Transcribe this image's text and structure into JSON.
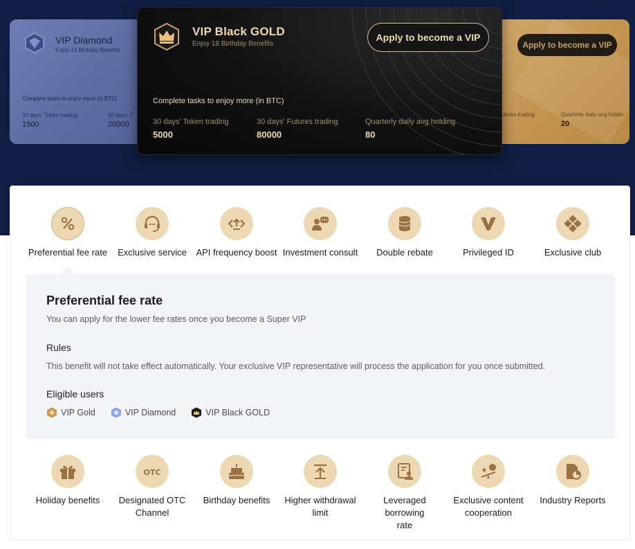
{
  "cards": {
    "diamond": {
      "title": "VIP Diamond",
      "subtitle": "Enjoy 13 Birthday Benefits",
      "tasks": "Complete tasks to enjoy more (in BTC)",
      "stats": [
        {
          "label": "30 days' Token trading",
          "value": "1500"
        },
        {
          "label": "30 days' F",
          "value": "20000"
        }
      ]
    },
    "black": {
      "title": "VIP Black GOLD",
      "subtitle": "Enjoy 18 Birthday Benefits",
      "apply_label": "Apply to become a VIP",
      "tasks": "Complete tasks to enjoy more (in BTC)",
      "stats": [
        {
          "label": "30 days' Token trading",
          "value": "5000"
        },
        {
          "label": "30 days' Futures trading",
          "value": "80000"
        },
        {
          "label": "Quarterly daily avg holding",
          "value": "80"
        }
      ]
    },
    "gold": {
      "apply_label": "Apply to become a VIP",
      "stats": [
        {
          "label": "utures trading",
          "value": ""
        },
        {
          "label": "Quarterly daily avg holdin",
          "value": "20"
        }
      ]
    }
  },
  "benefits_top": [
    {
      "label": "Preferential fee rate",
      "icon": "percent-icon"
    },
    {
      "label": "Exclusive service",
      "icon": "headset-icon"
    },
    {
      "label": "API frequency boost",
      "icon": "api-icon"
    },
    {
      "label": "Investment consult",
      "icon": "consult-icon"
    },
    {
      "label": "Double rebate",
      "icon": "coins-icon"
    },
    {
      "label": "Privileged ID",
      "icon": "v-icon"
    },
    {
      "label": "Exclusive club",
      "icon": "club-icon"
    }
  ],
  "detail": {
    "title": "Preferential fee rate",
    "description": "You can apply for the lower fee rates once you become a Super VIP",
    "rules_heading": "Rules",
    "rules_text": "This benefit will not take effect automatically. Your exclusive VIP representative will process the application for you once submitted.",
    "eligible_heading": "Eligible users",
    "eligible_users": [
      "VIP Gold",
      "VIP Diamond",
      "VIP Black GOLD"
    ]
  },
  "benefits_bottom": [
    {
      "line1": "Holiday benefits",
      "line2": "",
      "icon": "gift-icon"
    },
    {
      "line1": "Designated OTC",
      "line2": "Channel",
      "icon": "otc-icon"
    },
    {
      "line1": "Birthday benefits",
      "line2": "",
      "icon": "cake-icon"
    },
    {
      "line1": "Higher withdrawal",
      "line2": "limit",
      "icon": "upload-icon"
    },
    {
      "line1": "Leveraged borrowing",
      "line2": "rate",
      "icon": "borrow-icon"
    },
    {
      "line1": "Exclusive content",
      "line2": "cooperation",
      "icon": "content-icon"
    },
    {
      "line1": "Industry Reports",
      "line2": "",
      "icon": "report-icon"
    }
  ],
  "colors": {
    "band": "#0f1e42",
    "gold_accent": "#f0d9b0",
    "icon_circle": "#ecd8b2",
    "icon_fg": "#9a7140"
  }
}
